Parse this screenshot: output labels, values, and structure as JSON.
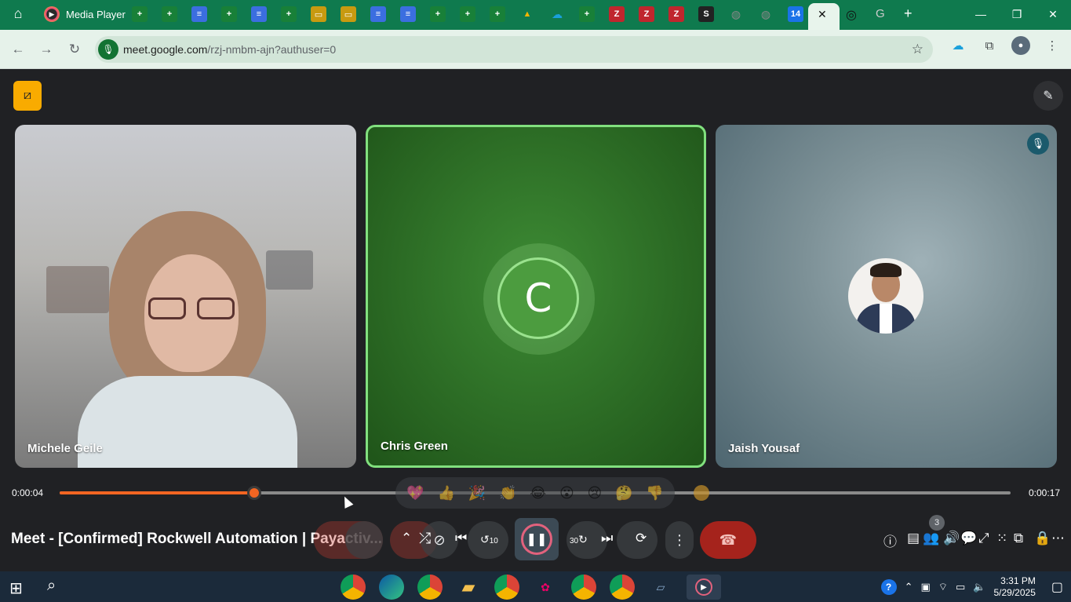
{
  "titlebar": {
    "app_name": "Media Player",
    "tabs": [
      {
        "icon": "sheets-icon"
      },
      {
        "icon": "sheets-icon"
      },
      {
        "icon": "docs-icon"
      },
      {
        "icon": "sheets-icon"
      },
      {
        "icon": "docs-icon"
      },
      {
        "icon": "sheets-icon"
      },
      {
        "icon": "slides-icon"
      },
      {
        "icon": "slides-icon"
      },
      {
        "icon": "docs-icon"
      },
      {
        "icon": "docs-icon"
      },
      {
        "icon": "sheets-icon"
      },
      {
        "icon": "sheets-icon"
      },
      {
        "icon": "sheets-icon"
      },
      {
        "icon": "drive-icon"
      },
      {
        "icon": "salesforce-icon"
      },
      {
        "icon": "sheets-icon"
      },
      {
        "icon": "zoho-icon"
      },
      {
        "icon": "zoho-icon"
      },
      {
        "icon": "zoho-icon"
      },
      {
        "icon": "s-icon"
      },
      {
        "icon": "globe-icon"
      },
      {
        "icon": "globe-icon"
      },
      {
        "icon": "calendar-icon"
      }
    ],
    "calendar_day": "14"
  },
  "addressbar": {
    "url_host": "meet.google.com",
    "url_path": "/rzj-nmbm-ajn?authuser=0"
  },
  "participants": [
    {
      "name": "Michele Geile"
    },
    {
      "name": "Chris Green",
      "initial": "C"
    },
    {
      "name": "Jaish Yousaf"
    }
  ],
  "player": {
    "current_time": "0:00:04",
    "total_time": "0:00:17",
    "progress": 0.205,
    "title": "Meet - [Confirmed] Rockwell Automation | Payactiv...",
    "skip_back_label": "10",
    "skip_forward_label": "30",
    "participants_count": "3"
  },
  "reactions": [
    "💖",
    "👍",
    "🎉",
    "👏",
    "😂",
    "😮",
    "😢",
    "🤔",
    "👎"
  ],
  "taskbar": {
    "time": "3:31 PM",
    "date": "5/29/2025"
  },
  "colors": {
    "seek_accent": "#f26522",
    "active_speaker_border": "#81e07e",
    "hangup": "#a5231c",
    "meet_background": "#202124"
  }
}
